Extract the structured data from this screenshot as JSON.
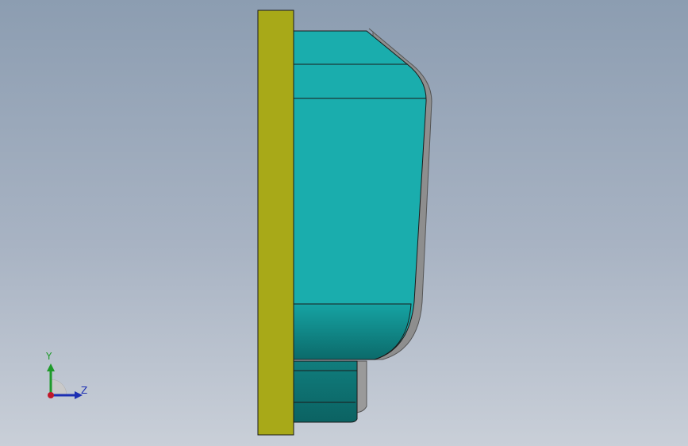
{
  "triad": {
    "y_label": "Y",
    "z_label": "Z",
    "colors": {
      "y_axis": "#1e9a2a",
      "z_axis": "#1c2fb3",
      "x_axis": "#c0182a"
    }
  },
  "model": {
    "colors": {
      "base_plate": "#a8a918",
      "body_teal": "#1aadad",
      "body_teal_dark": "#0f7878",
      "shadow": "#8a8a8a"
    }
  }
}
